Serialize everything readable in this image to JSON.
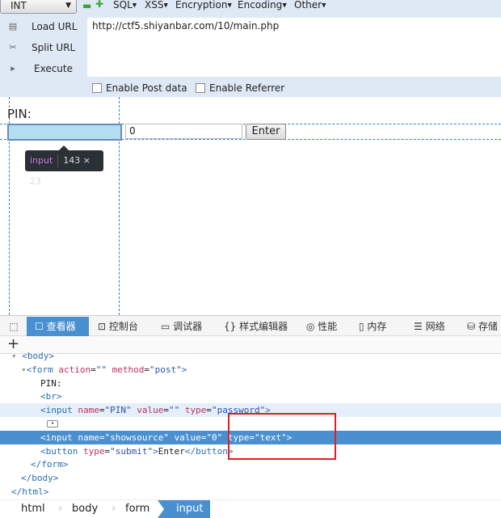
{
  "hackbar": {
    "select_value": "INT",
    "menus": [
      "SQL",
      "XSS",
      "Encryption",
      "Encoding",
      "Other"
    ],
    "side_buttons": [
      {
        "label": "Load URL",
        "icon": "load-icon"
      },
      {
        "label": "Split URL",
        "icon": "scissors-icon"
      },
      {
        "label": "Execute",
        "icon": "play-icon"
      }
    ],
    "url": "http://ctf5.shiyanbar.com/10/main.php",
    "checkboxes": [
      {
        "label": "Enable Post data",
        "checked": false
      },
      {
        "label": "Enable Referrer",
        "checked": false
      }
    ]
  },
  "page": {
    "pin_label": "PIN:",
    "showsource_value": "0",
    "enter_label": "Enter",
    "tooltip": {
      "tag": "input",
      "size": "143 × 23"
    }
  },
  "devtools": {
    "tabs": [
      "查看器",
      "控制台",
      "调试器",
      "样式编辑器",
      "性能",
      "内存",
      "网络",
      "存储"
    ],
    "active_tab": "查看器",
    "add_label": "+",
    "tree": {
      "body": "<body>",
      "form_open": [
        "<",
        "form",
        " action",
        "=",
        "\"\"",
        " method",
        "=",
        "\"post\"",
        ">"
      ],
      "pin_text": "PIN:",
      "br": "<br>",
      "input_pin": [
        "<",
        "input",
        " name",
        "=",
        "\"PIN\"",
        " value",
        "=",
        "\"\"",
        " type",
        "=",
        "\"password\"",
        ">"
      ],
      "input_src": [
        "<",
        "input",
        " name",
        "=",
        "\"showsource\"",
        " value",
        "=",
        "\"0\"",
        " type",
        "=",
        "\"text\"",
        ">"
      ],
      "button_a": [
        "<",
        "button",
        " type",
        "=",
        "\"submit\"",
        ">",
        "Enter",
        "</",
        "button",
        ">"
      ],
      "form_close": "</form>",
      "body_close": "</body>",
      "html_close": "</html>"
    },
    "breadcrumbs": [
      "html",
      "body",
      "form",
      "input"
    ]
  },
  "colors": {
    "accent": "#4a90d0",
    "highlight_box": "#e02020"
  }
}
